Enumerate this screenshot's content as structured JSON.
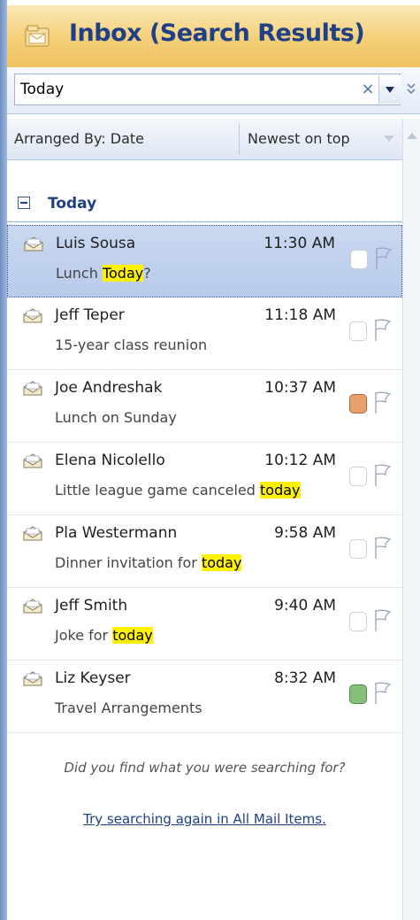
{
  "header": {
    "title": "Inbox (Search Results)"
  },
  "search": {
    "value": "Today",
    "clear_glyph": "×"
  },
  "arrange": {
    "label": "Arranged By: Date",
    "sort_label": "Newest on top"
  },
  "group": {
    "label": "Today"
  },
  "mails": [
    {
      "sender": "Luis Sousa",
      "time": "11:30 AM",
      "subject_pre": "Lunch ",
      "subject_hl": "Today",
      "subject_post": "?",
      "category": "none",
      "selected": true
    },
    {
      "sender": "Jeff Teper",
      "time": "11:18 AM",
      "subject_pre": "15-year class reunion",
      "subject_hl": "",
      "subject_post": "",
      "category": "none",
      "selected": false
    },
    {
      "sender": "Joe Andreshak",
      "time": "10:37 AM",
      "subject_pre": "Lunch on Sunday",
      "subject_hl": "",
      "subject_post": "",
      "category": "orange",
      "selected": false
    },
    {
      "sender": "Elena Nicolello",
      "time": "10:12 AM",
      "subject_pre": "Little league game canceled ",
      "subject_hl": "today",
      "subject_post": "",
      "category": "none",
      "selected": false
    },
    {
      "sender": "Pla Westermann",
      "time": "9:58 AM",
      "subject_pre": "Dinner invitation for ",
      "subject_hl": "today",
      "subject_post": "",
      "category": "none",
      "selected": false
    },
    {
      "sender": "Jeff Smith",
      "time": "9:40 AM",
      "subject_pre": "Joke for ",
      "subject_hl": "today",
      "subject_post": "",
      "category": "none",
      "selected": false
    },
    {
      "sender": "Liz Keyser",
      "time": "8:32 AM",
      "subject_pre": "Travel Arrangements",
      "subject_hl": "",
      "subject_post": "",
      "category": "green",
      "selected": false
    }
  ],
  "footer": {
    "prompt": "Did you find what you were searching for?",
    "retry_link": "Try searching again in All Mail Items."
  },
  "icons": {
    "header": "folder-icon",
    "mail": "envelope-icon",
    "flag": "flag-icon",
    "category": "category-box",
    "clear": "close-icon",
    "dropdown": "chevron-down-icon"
  },
  "colors": {
    "header_title": "#1f3f86",
    "highlight": "#fff200",
    "category_orange": "#e7a06c",
    "category_green": "#84c07a",
    "selection": "#c2d3ee"
  }
}
